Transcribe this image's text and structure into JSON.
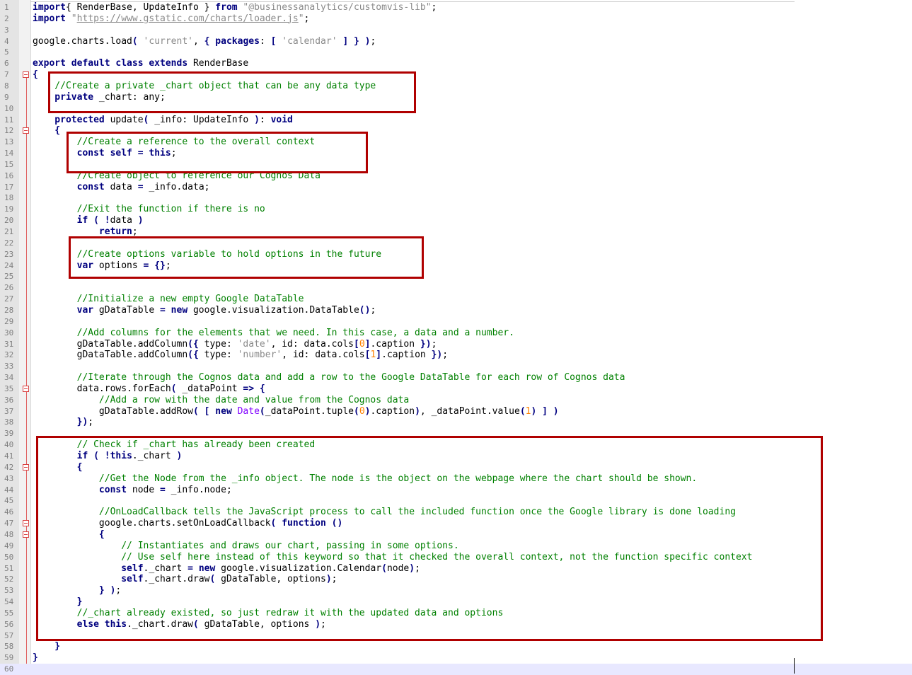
{
  "editor": {
    "lines": [
      {
        "n": "1",
        "t": [
          [
            "kw",
            "import"
          ],
          [
            "",
            "{ RenderBase, UpdateInfo } "
          ],
          [
            "kw",
            "from"
          ],
          [
            "str",
            " \"@businessanalytics/customvis-lib\""
          ],
          [
            "",
            ";"
          ]
        ]
      },
      {
        "n": "2",
        "t": [
          [
            "kw",
            "import"
          ],
          [
            "str",
            " \""
          ],
          [
            "url",
            "https://www.gstatic.com/charts/loader.js"
          ],
          [
            "str",
            "\""
          ],
          [
            "",
            ";"
          ]
        ]
      },
      {
        "n": "3",
        "t": []
      },
      {
        "n": "4",
        "t": [
          [
            "",
            "google.charts.load"
          ],
          [
            "op",
            "("
          ],
          [
            "str",
            " 'current'"
          ],
          [
            "",
            ", "
          ],
          [
            "op",
            "{"
          ],
          [
            "kw",
            " packages"
          ],
          [
            "",
            ": "
          ],
          [
            "op",
            "["
          ],
          [
            "str",
            " 'calendar'"
          ],
          [
            "op",
            " ] } )"
          ],
          [
            "",
            ";"
          ]
        ]
      },
      {
        "n": "5",
        "t": []
      },
      {
        "n": "6",
        "t": [
          [
            "kw",
            "export default class extends"
          ],
          [
            "",
            " RenderBase"
          ]
        ]
      },
      {
        "n": "7",
        "t": [
          [
            "op",
            "{"
          ]
        ],
        "fold": true
      },
      {
        "n": "8",
        "t": [
          [
            "cmt",
            "    //Create a private _chart object that can be any data type"
          ]
        ]
      },
      {
        "n": "9",
        "t": [
          [
            "kw",
            "    private"
          ],
          [
            "",
            " _chart: any;"
          ]
        ]
      },
      {
        "n": "10",
        "t": []
      },
      {
        "n": "11",
        "t": [
          [
            "kw",
            "    protected"
          ],
          [
            "",
            " update"
          ],
          [
            "op",
            "("
          ],
          [
            "",
            " _info: UpdateInfo "
          ],
          [
            "op",
            ")"
          ],
          [
            "",
            ": "
          ],
          [
            "kw",
            "void"
          ]
        ]
      },
      {
        "n": "12",
        "t": [
          [
            "op",
            "    {"
          ]
        ],
        "fold": true
      },
      {
        "n": "13",
        "t": [
          [
            "cmt",
            "        //Create a reference to the overall context"
          ]
        ]
      },
      {
        "n": "14",
        "t": [
          [
            "kw",
            "        const self"
          ],
          [
            "op",
            " ="
          ],
          [
            "kw",
            " this"
          ],
          [
            "",
            ";"
          ]
        ]
      },
      {
        "n": "15",
        "t": []
      },
      {
        "n": "16",
        "t": [
          [
            "cmt",
            "        //Create object to reference our Cognos Data"
          ]
        ]
      },
      {
        "n": "17",
        "t": [
          [
            "kw",
            "        const"
          ],
          [
            "",
            " data "
          ],
          [
            "op",
            "="
          ],
          [
            "",
            " _info.data;"
          ]
        ]
      },
      {
        "n": "18",
        "t": []
      },
      {
        "n": "19",
        "t": [
          [
            "cmt",
            "        //Exit the function if there is no"
          ]
        ]
      },
      {
        "n": "20",
        "t": [
          [
            "kw",
            "        if"
          ],
          [
            "op",
            " ( !"
          ],
          [
            "",
            "data "
          ],
          [
            "op",
            ")"
          ]
        ]
      },
      {
        "n": "21",
        "t": [
          [
            "kw",
            "            return"
          ],
          [
            "",
            ";"
          ]
        ]
      },
      {
        "n": "22",
        "t": []
      },
      {
        "n": "23",
        "t": [
          [
            "cmt",
            "        //Create options variable to hold options in the future"
          ]
        ]
      },
      {
        "n": "24",
        "t": [
          [
            "kw",
            "        var"
          ],
          [
            "",
            " options "
          ],
          [
            "op",
            "= {}"
          ],
          [
            "",
            ";"
          ]
        ]
      },
      {
        "n": "25",
        "t": []
      },
      {
        "n": "26",
        "t": []
      },
      {
        "n": "27",
        "t": [
          [
            "cmt",
            "        //Initialize a new empty Google DataTable"
          ]
        ]
      },
      {
        "n": "28",
        "t": [
          [
            "kw",
            "        var"
          ],
          [
            "",
            " gDataTable "
          ],
          [
            "op",
            "="
          ],
          [
            "kw",
            " new"
          ],
          [
            "",
            " google.visualization.DataTable"
          ],
          [
            "op",
            "()"
          ],
          [
            "",
            ";"
          ]
        ]
      },
      {
        "n": "29",
        "t": []
      },
      {
        "n": "30",
        "t": [
          [
            "cmt",
            "        //Add columns for the elements that we need. In this case, a data and a number."
          ]
        ]
      },
      {
        "n": "31",
        "t": [
          [
            "",
            "        gDataTable.addColumn"
          ],
          [
            "op",
            "({"
          ],
          [
            "",
            " type: "
          ],
          [
            "str",
            "'date'"
          ],
          [
            "",
            ", id: data.cols"
          ],
          [
            "op",
            "["
          ],
          [
            "num",
            "0"
          ],
          [
            "op",
            "]"
          ],
          [
            "",
            ".caption "
          ],
          [
            "op",
            "})"
          ],
          [
            "",
            ";"
          ]
        ]
      },
      {
        "n": "32",
        "t": [
          [
            "",
            "        gDataTable.addColumn"
          ],
          [
            "op",
            "({"
          ],
          [
            "",
            " type: "
          ],
          [
            "str",
            "'number'"
          ],
          [
            "",
            ", id: data.cols"
          ],
          [
            "op",
            "["
          ],
          [
            "num",
            "1"
          ],
          [
            "op",
            "]"
          ],
          [
            "",
            ".caption "
          ],
          [
            "op",
            "})"
          ],
          [
            "",
            ";"
          ]
        ]
      },
      {
        "n": "33",
        "t": []
      },
      {
        "n": "34",
        "t": [
          [
            "cmt",
            "        //Iterate through the Cognos data and add a row to the Google DataTable for each row of Cognos data"
          ]
        ]
      },
      {
        "n": "35",
        "t": [
          [
            "",
            "        data.rows.forEach"
          ],
          [
            "op",
            "("
          ],
          [
            "",
            " _dataPoint "
          ],
          [
            "op",
            "=> {"
          ]
        ],
        "fold": true
      },
      {
        "n": "36",
        "t": [
          [
            "cmt",
            "            //Add a row with the date and value from the Cognos data"
          ]
        ]
      },
      {
        "n": "37",
        "t": [
          [
            "",
            "            gDataTable.addRow"
          ],
          [
            "op",
            "( ["
          ],
          [
            "kw",
            " new"
          ],
          [
            "cls",
            " Date"
          ],
          [
            "op",
            "("
          ],
          [
            "",
            "_dataPoint.tuple"
          ],
          [
            "op",
            "("
          ],
          [
            "num",
            "0"
          ],
          [
            "op",
            ")"
          ],
          [
            "",
            ".caption"
          ],
          [
            "op",
            ")"
          ],
          [
            "",
            ", _dataPoint.value"
          ],
          [
            "op",
            "("
          ],
          [
            "num",
            "1"
          ],
          [
            "op",
            ") ] )"
          ]
        ]
      },
      {
        "n": "38",
        "t": [
          [
            "op",
            "        })"
          ],
          [
            "",
            ";"
          ]
        ]
      },
      {
        "n": "39",
        "t": []
      },
      {
        "n": "40",
        "t": [
          [
            "cmt",
            "        // Check if _chart has already been created"
          ]
        ]
      },
      {
        "n": "41",
        "t": [
          [
            "kw",
            "        if"
          ],
          [
            "op",
            " ( !"
          ],
          [
            "kw",
            "this"
          ],
          [
            "",
            "._chart "
          ],
          [
            "op",
            ")"
          ]
        ]
      },
      {
        "n": "42",
        "t": [
          [
            "op",
            "        {"
          ]
        ],
        "fold": true
      },
      {
        "n": "43",
        "t": [
          [
            "cmt",
            "            //Get the Node from the _info object. The node is the object on the webpage where the chart should be shown."
          ]
        ]
      },
      {
        "n": "44",
        "t": [
          [
            "kw",
            "            const"
          ],
          [
            "",
            " node "
          ],
          [
            "op",
            "="
          ],
          [
            "",
            " _info.node;"
          ]
        ]
      },
      {
        "n": "45",
        "t": []
      },
      {
        "n": "46",
        "t": [
          [
            "cmt",
            "            //OnLoadCallback tells the JavaScript process to call the included function once the Google library is done loading"
          ]
        ]
      },
      {
        "n": "47",
        "t": [
          [
            "",
            "            google.charts.setOnLoadCallback"
          ],
          [
            "op",
            "("
          ],
          [
            "kw",
            " function"
          ],
          [
            "op",
            " ()"
          ]
        ],
        "fold": true
      },
      {
        "n": "48",
        "t": [
          [
            "op",
            "            {"
          ]
        ],
        "fold": true
      },
      {
        "n": "49",
        "t": [
          [
            "cmt",
            "                // Instantiates and draws our chart, passing in some options."
          ]
        ]
      },
      {
        "n": "50",
        "t": [
          [
            "cmt",
            "                // Use self here instead of this keyword so that it checked the overall context, not the function specific context"
          ]
        ]
      },
      {
        "n": "51",
        "t": [
          [
            "kw",
            "                self"
          ],
          [
            "",
            "._chart "
          ],
          [
            "op",
            "="
          ],
          [
            "kw",
            " new"
          ],
          [
            "",
            " google.visualization.Calendar"
          ],
          [
            "op",
            "("
          ],
          [
            "",
            "node"
          ],
          [
            "op",
            ")"
          ],
          [
            "",
            ";"
          ]
        ]
      },
      {
        "n": "52",
        "t": [
          [
            "kw",
            "                self"
          ],
          [
            "",
            "._chart.draw"
          ],
          [
            "op",
            "("
          ],
          [
            "",
            " gDataTable, options"
          ],
          [
            "op",
            ")"
          ],
          [
            "",
            ";"
          ]
        ]
      },
      {
        "n": "53",
        "t": [
          [
            "op",
            "            } )"
          ],
          [
            "",
            ";"
          ]
        ]
      },
      {
        "n": "54",
        "t": [
          [
            "op",
            "        }"
          ]
        ]
      },
      {
        "n": "55",
        "t": [
          [
            "cmt",
            "        //_chart already existed, so just redraw it with the updated data and options"
          ]
        ]
      },
      {
        "n": "56",
        "t": [
          [
            "kw",
            "        else this"
          ],
          [
            "",
            "._chart.draw"
          ],
          [
            "op",
            "("
          ],
          [
            "",
            " gDataTable, options "
          ],
          [
            "op",
            ")"
          ],
          [
            "",
            ";"
          ]
        ]
      },
      {
        "n": "57",
        "t": []
      },
      {
        "n": "58",
        "t": [
          [
            "op",
            "    }"
          ]
        ]
      },
      {
        "n": "59",
        "t": [
          [
            "op",
            "}"
          ]
        ]
      },
      {
        "n": "60",
        "t": [],
        "current": true
      }
    ]
  }
}
